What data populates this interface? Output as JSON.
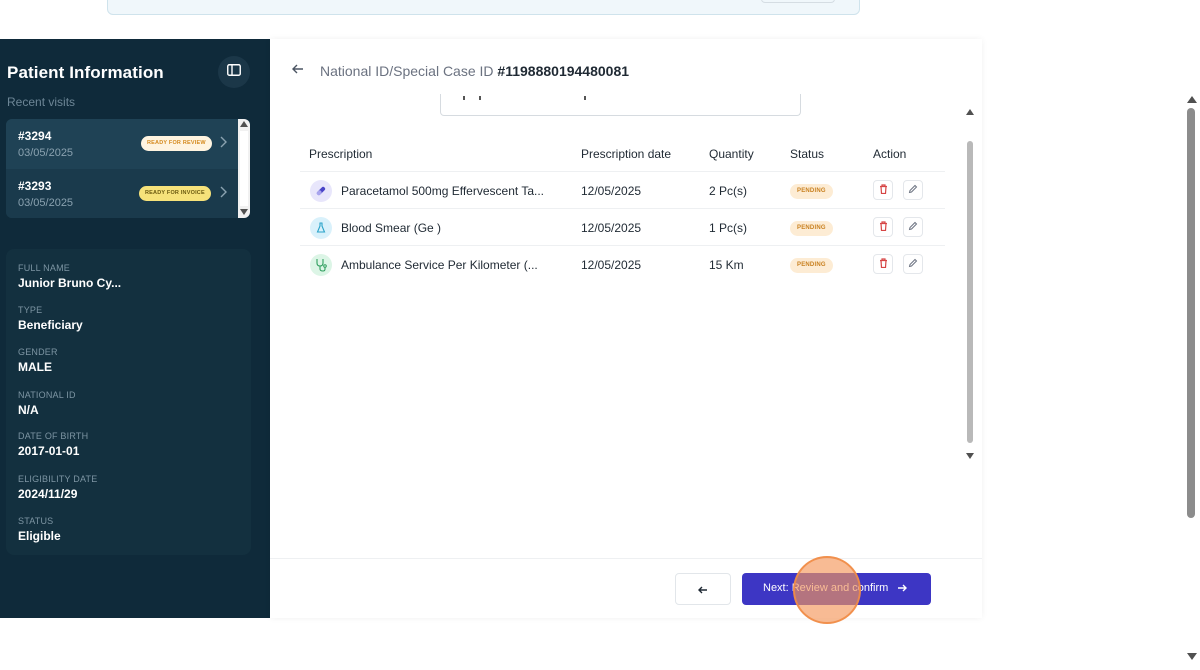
{
  "sidebar": {
    "title": "Patient Information",
    "recent_visits_label": "Recent visits",
    "visits": [
      {
        "id": "#3294",
        "date": "03/05/2025",
        "badge": "READY FOR REVIEW"
      },
      {
        "id": "#3293",
        "date": "03/05/2025",
        "badge": "READY FOR INVOICE"
      }
    ],
    "patient": {
      "full_name_label": "FULL NAME",
      "full_name": "Junior Bruno Cy...",
      "type_label": "TYPE",
      "type": "Beneficiary",
      "gender_label": "GENDER",
      "gender": "MALE",
      "national_id_label": "NATIONAL ID",
      "national_id": "N/A",
      "dob_label": "DATE OF BIRTH",
      "dob": "2017-01-01",
      "eligibility_label": "ELIGIBILITY DATE",
      "eligibility": "2024/11/29",
      "status_label": "STATUS",
      "status": "Eligible"
    }
  },
  "main": {
    "case_label": "National ID/Special Case ID",
    "case_id": "#1198880194480081",
    "table": {
      "headers": [
        "Prescription",
        "Prescription date",
        "Quantity",
        "Status",
        "Action"
      ],
      "rows": [
        {
          "name": "Paracetamol 500mg Effervescent Ta...",
          "date": "12/05/2025",
          "quantity": "2 Pc(s)",
          "status": "PENDING",
          "icon": "pill-icon"
        },
        {
          "name": "Blood Smear (Ge )",
          "date": "12/05/2025",
          "quantity": "1 Pc(s)",
          "status": "PENDING",
          "icon": "flask-icon"
        },
        {
          "name": "Ambulance Service Per Kilometer (...",
          "date": "12/05/2025",
          "quantity": "15 Km",
          "status": "PENDING",
          "icon": "stethoscope-icon"
        }
      ]
    },
    "footer": {
      "next_label": "Next: Review and confirm"
    }
  },
  "colors": {
    "sidebar_bg": "#0f2a3a",
    "primary_button": "#3d36c4",
    "pending_badge_bg": "#fdecd4",
    "delete_icon": "#d64545"
  }
}
